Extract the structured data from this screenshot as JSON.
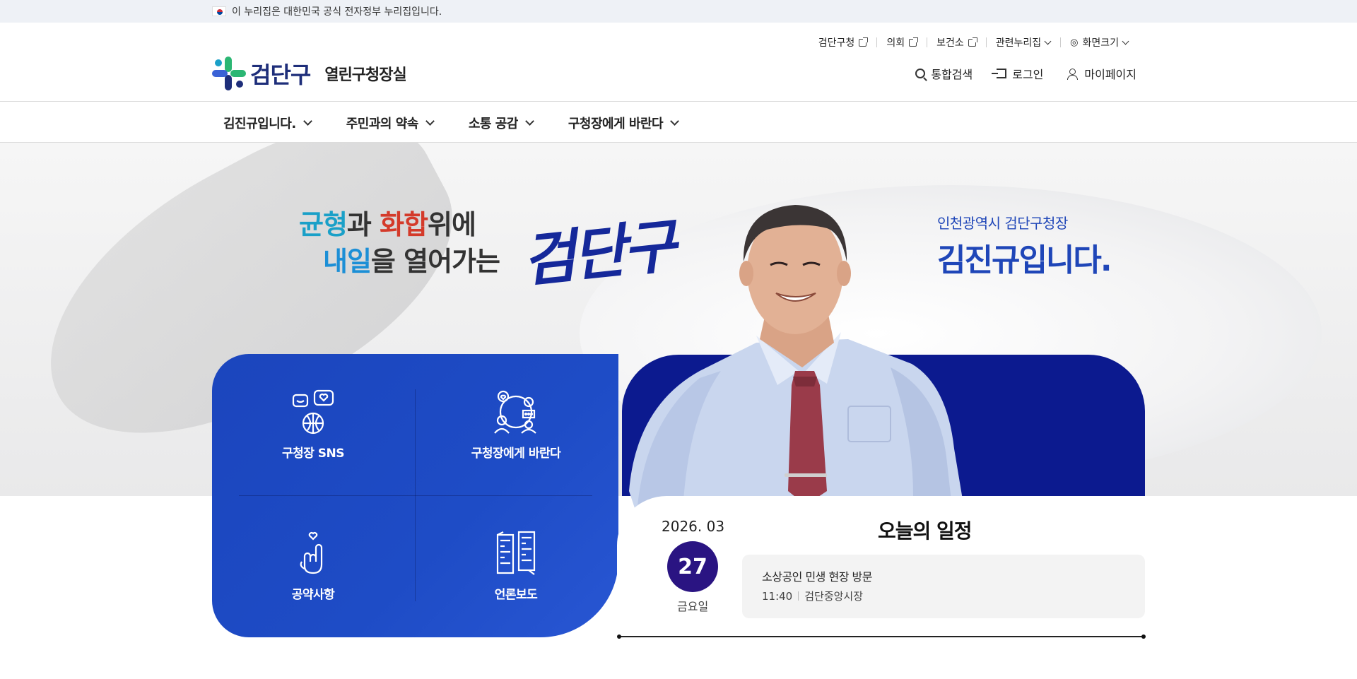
{
  "gov_banner": {
    "text": "이 누리집은 대한민국 공식 전자정부 누리집입니다."
  },
  "header": {
    "logo_name": "검단구",
    "site_title": "열린구청장실",
    "util_top": [
      {
        "label": "검단구청",
        "icon": "external-link-icon"
      },
      {
        "label": "의회",
        "icon": "external-link-icon"
      },
      {
        "label": "보건소",
        "icon": "external-link-icon"
      },
      {
        "label": "관련누리집",
        "icon": "chevron-down-icon"
      },
      {
        "label": "화면크기",
        "icon": "chevron-down-icon"
      }
    ],
    "util_main": [
      {
        "label": "통합검색",
        "icon": "search-icon"
      },
      {
        "label": "로그인",
        "icon": "login-icon"
      },
      {
        "label": "마이페이지",
        "icon": "user-icon"
      }
    ]
  },
  "gnb": [
    {
      "label": "김진규입니다."
    },
    {
      "label": "주민과의 약속"
    },
    {
      "label": "소통 공감"
    },
    {
      "label": "구청장에게 바란다"
    }
  ],
  "visual": {
    "slogan_line1": {
      "a": "균형",
      "b": "과 ",
      "c": "화합",
      "d": "위에"
    },
    "slogan_line2": {
      "a": "내일",
      "b": "을 열어가는"
    },
    "brush_text": "검단구",
    "mayor_title": "인천광역시 검단구청장",
    "mayor_name": "김진규입니다."
  },
  "quick_menu": [
    {
      "label": "구청장 SNS",
      "icon": "sns-globe-icon"
    },
    {
      "label": "구청장에게 바란다",
      "icon": "conversation-icon"
    },
    {
      "label": "공약사항",
      "icon": "promise-hand-icon"
    },
    {
      "label": "언론보도",
      "icon": "press-news-icon"
    }
  ],
  "schedule": {
    "year_month": "2026. 03",
    "day": "27",
    "weekday": "금요일",
    "title": "오늘의 일정",
    "event": "소상공인 민생 현장 방문",
    "time": "11:40",
    "place": "검단중앙시장"
  },
  "colors": {
    "brand_navy": "#1e2e7a",
    "quick_blue": "#1e4cc6",
    "visual_navy": "#0c1a8f",
    "date_circle": "#2a1482",
    "mayor_blue": "#1f46b8"
  }
}
